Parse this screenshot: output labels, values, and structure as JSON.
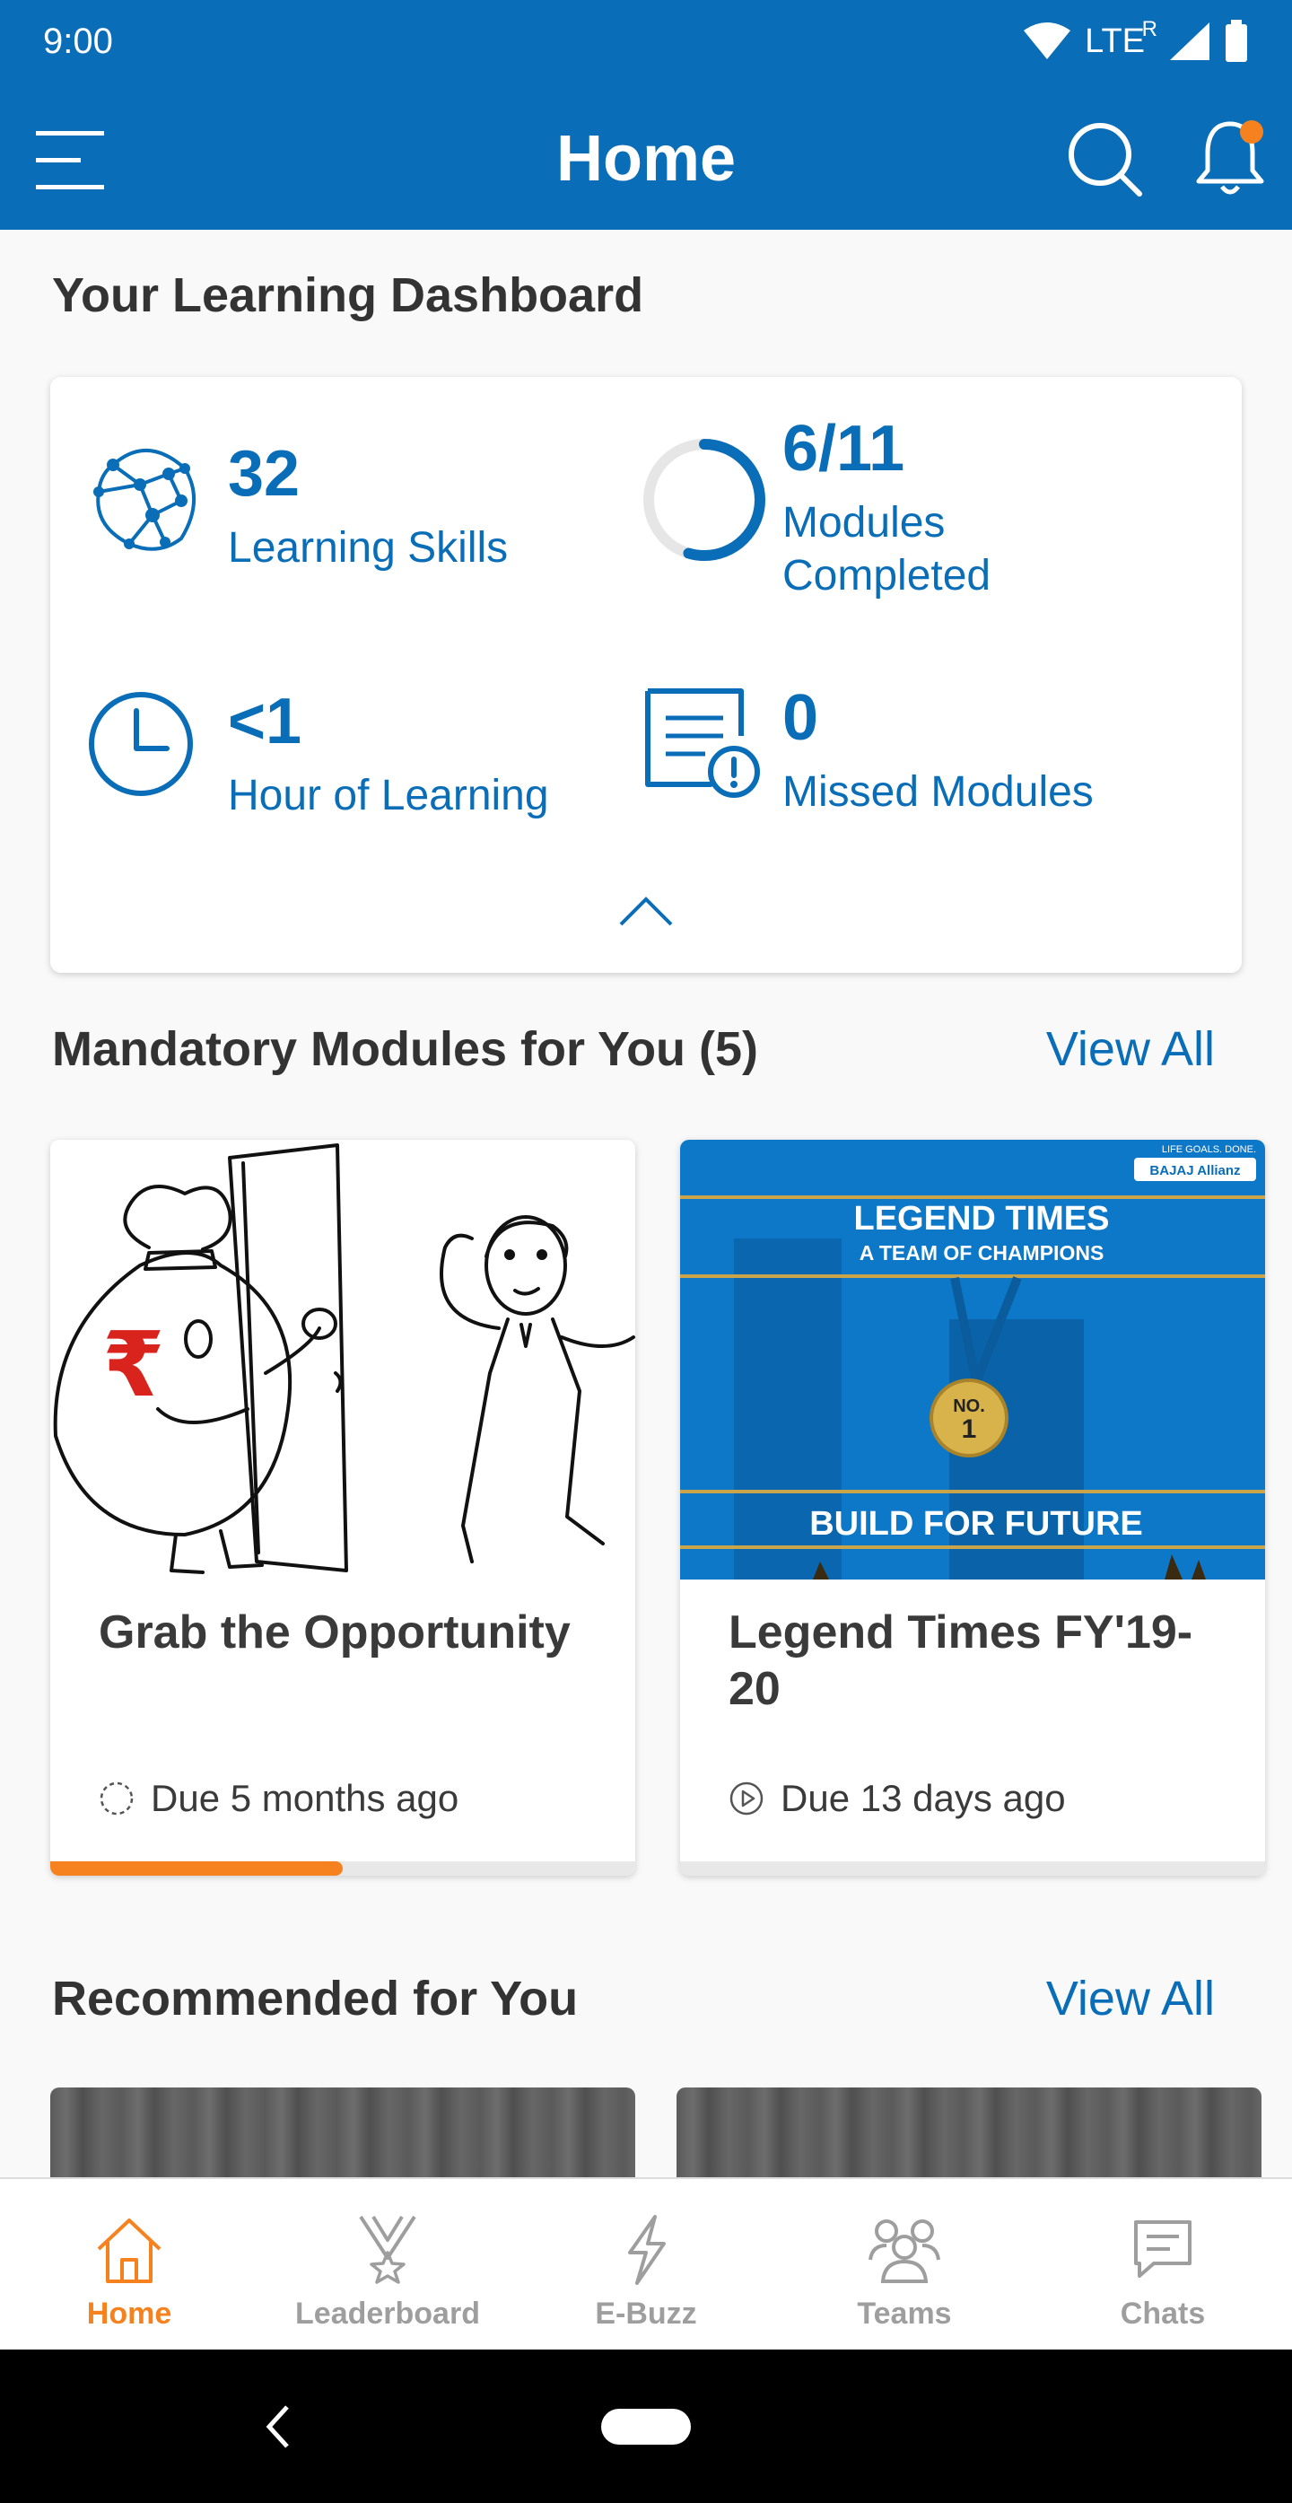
{
  "status_bar": {
    "time": "9:00",
    "network": "LTE",
    "roaming": "R"
  },
  "header": {
    "title": "Home"
  },
  "dashboard": {
    "title": "Your Learning Dashboard",
    "skills": {
      "value": "32",
      "label": "Learning Skills"
    },
    "modules": {
      "value": "6/11",
      "label": "Modules Completed",
      "completed": 6,
      "total": 11
    },
    "hours": {
      "value": "<1",
      "label": "Hour of Learning"
    },
    "missed": {
      "value": "0",
      "label": "Missed Modules"
    }
  },
  "mandatory": {
    "title": "Mandatory Modules for You (5)",
    "view_all": "View All",
    "cards": [
      {
        "title": "Grab the Opportunity",
        "due": "Due 5 months ago",
        "progress": 0.5,
        "icon": "pending-circle-icon"
      },
      {
        "title": "Legend Times FY'19-20",
        "due": "Due 13 days ago",
        "progress": 0,
        "icon": "play-circle-icon",
        "image_text": {
          "brand": "BAJAJ Allianz",
          "tagline": "LIFE GOALS. DONE.",
          "headline": "LEGEND TIMES",
          "subheadline": "A TEAM OF CHAMPIONS",
          "medal_top": "NO.",
          "medal_num": "1",
          "footer": "BUILD FOR FUTURE"
        }
      }
    ]
  },
  "recommended": {
    "title": "Recommended for You",
    "view_all": "View All"
  },
  "bottom_nav": {
    "items": [
      {
        "label": "Home"
      },
      {
        "label": "Leaderboard"
      },
      {
        "label": "E-Buzz"
      },
      {
        "label": "Teams"
      },
      {
        "label": "Chats"
      }
    ]
  },
  "colors": {
    "primary": "#0a6db7",
    "accent": "#f5821f"
  }
}
